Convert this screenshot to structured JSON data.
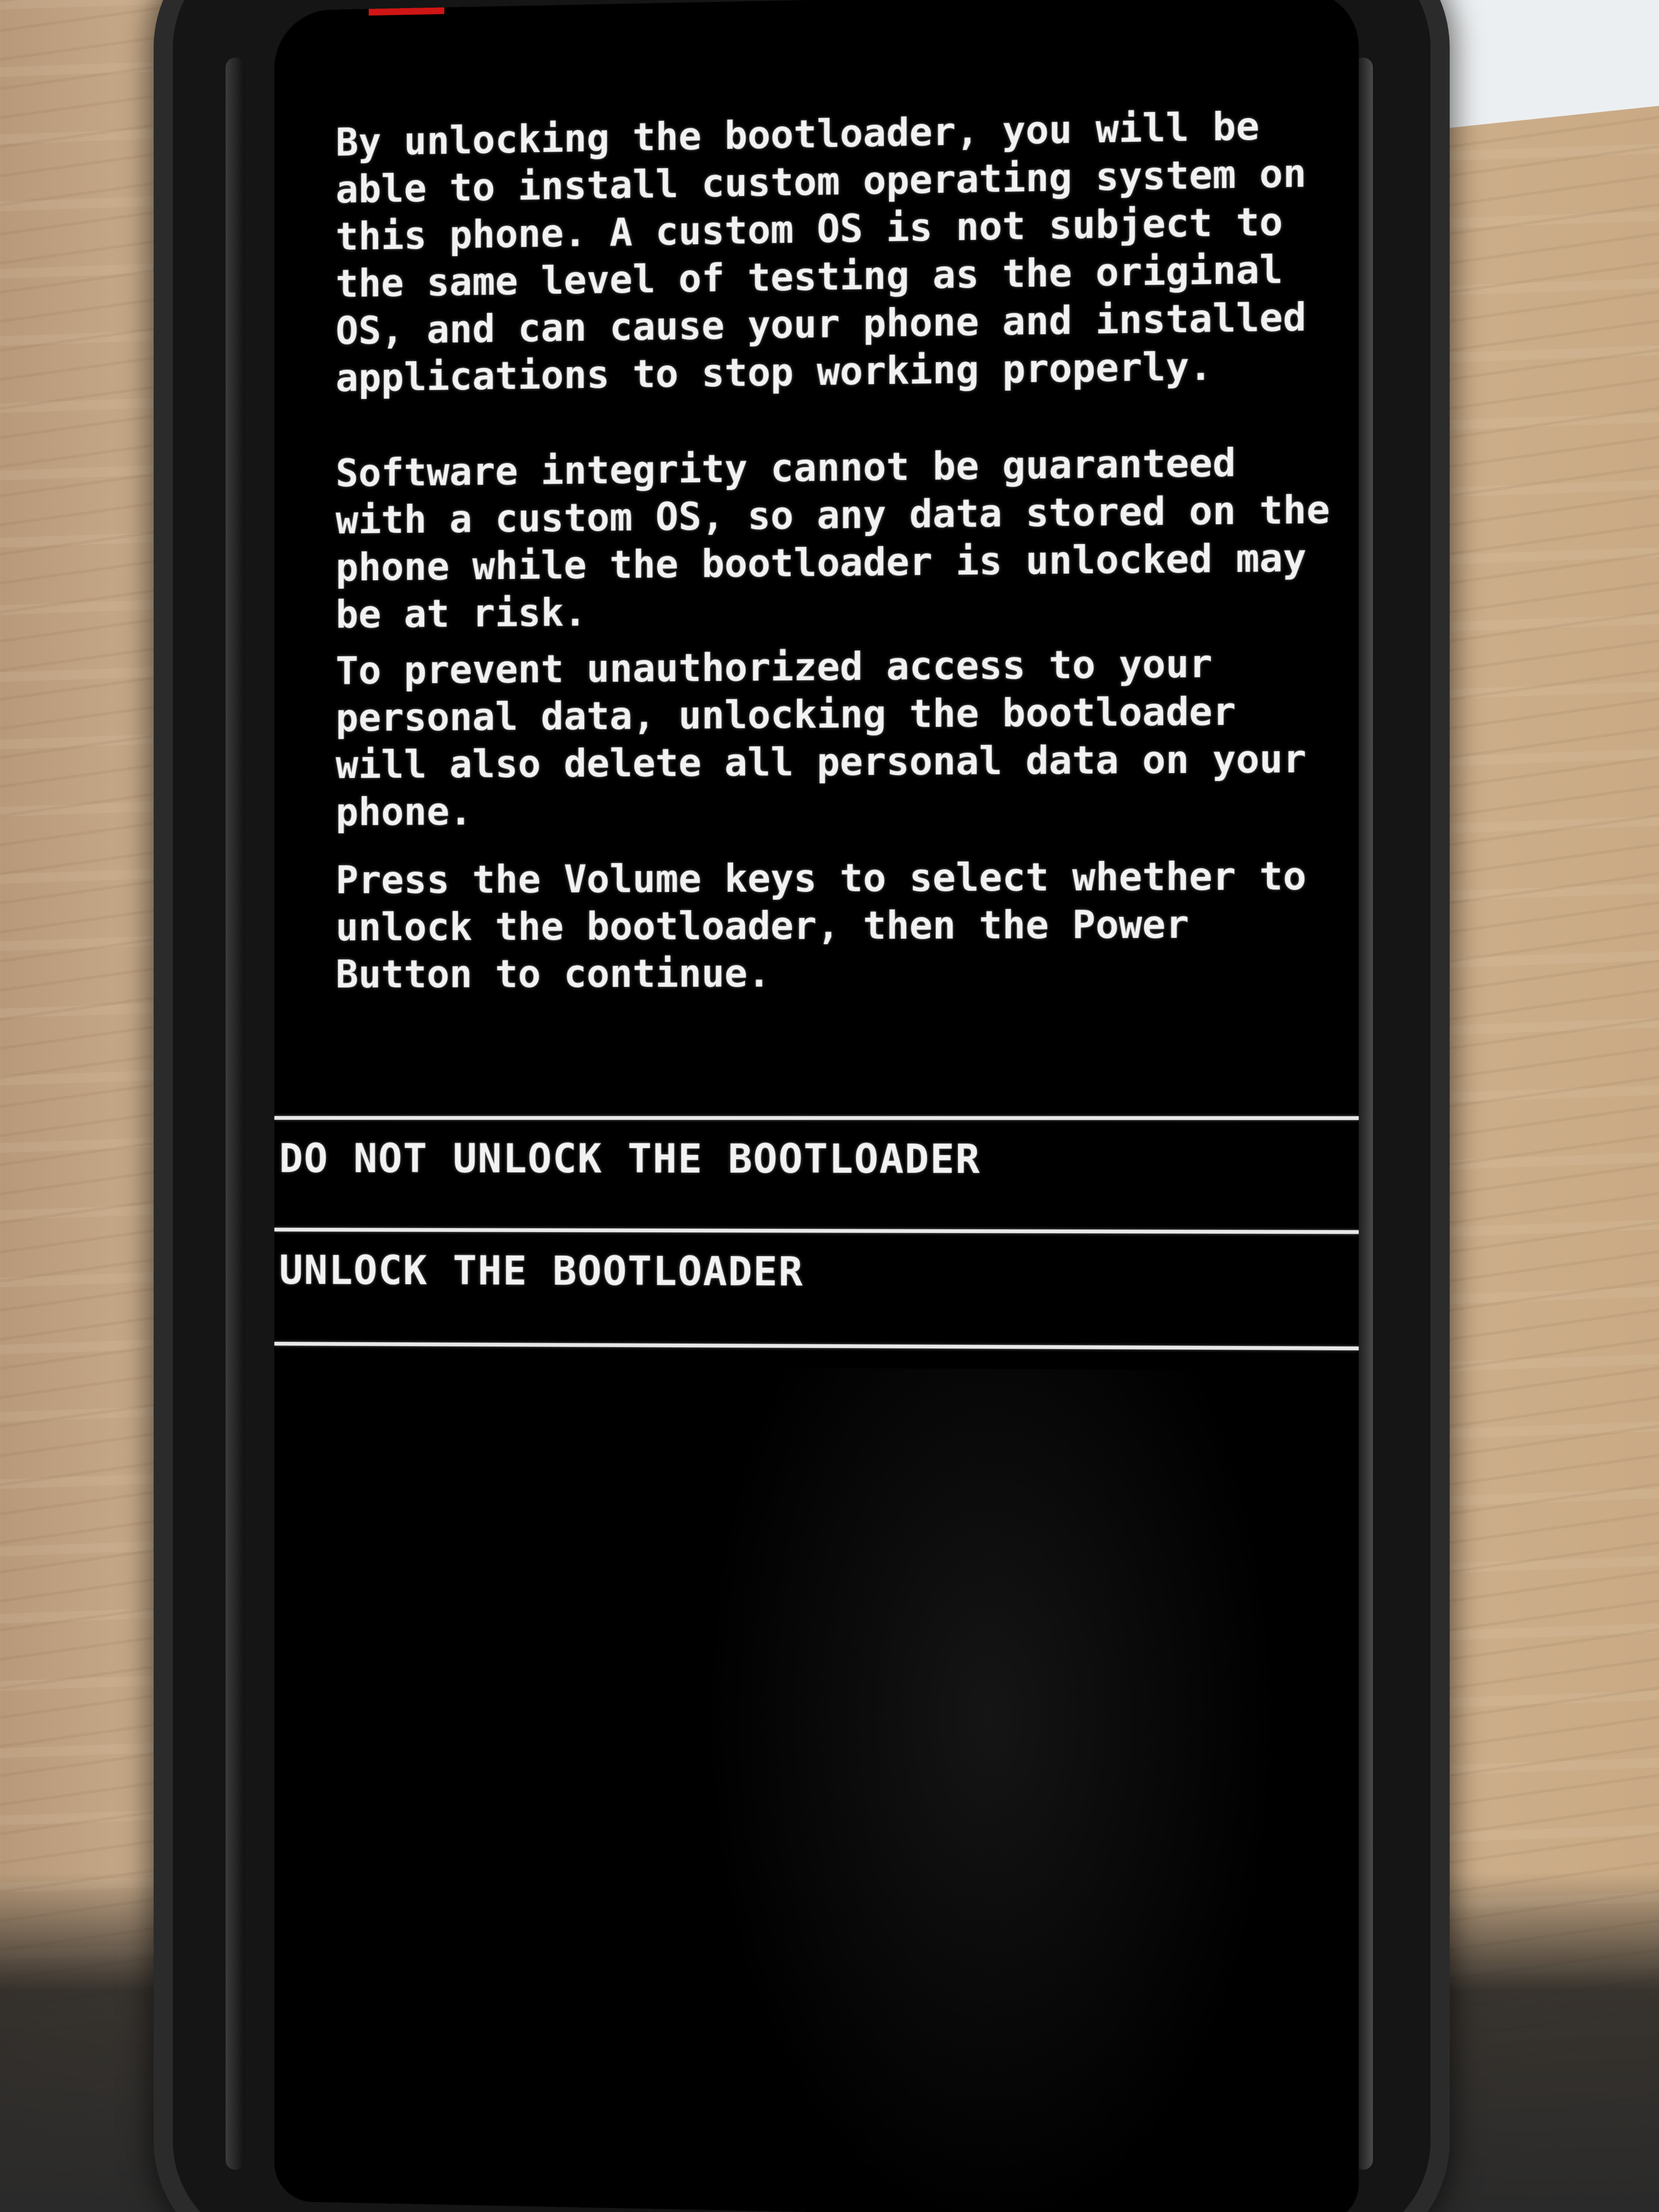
{
  "screen": {
    "paragraphs": [
      "By unlocking the bootloader, you will be able to install custom operating system on this phone. A custom OS is not subject to the same level of testing as the original OS, and can cause your phone and installed applications to stop working properly.",
      "Software integrity cannot be guaranteed with a custom OS, so any data stored on the phone while the bootloader is unlocked may be at risk.",
      "To prevent unauthorized access to your personal data, unlocking the bootloader will also delete all personal data on your phone.",
      "Press the Volume keys to select whether to unlock the bootloader, then the Power Button to continue."
    ],
    "options": [
      "DO NOT UNLOCK THE BOOTLOADER",
      "UNLOCK THE BOOTLOADER"
    ]
  },
  "colors": {
    "screen_background": "#000000",
    "text": "#f2f2f2",
    "divider": "#e8e8e8",
    "top_indicator": "#d01515"
  }
}
